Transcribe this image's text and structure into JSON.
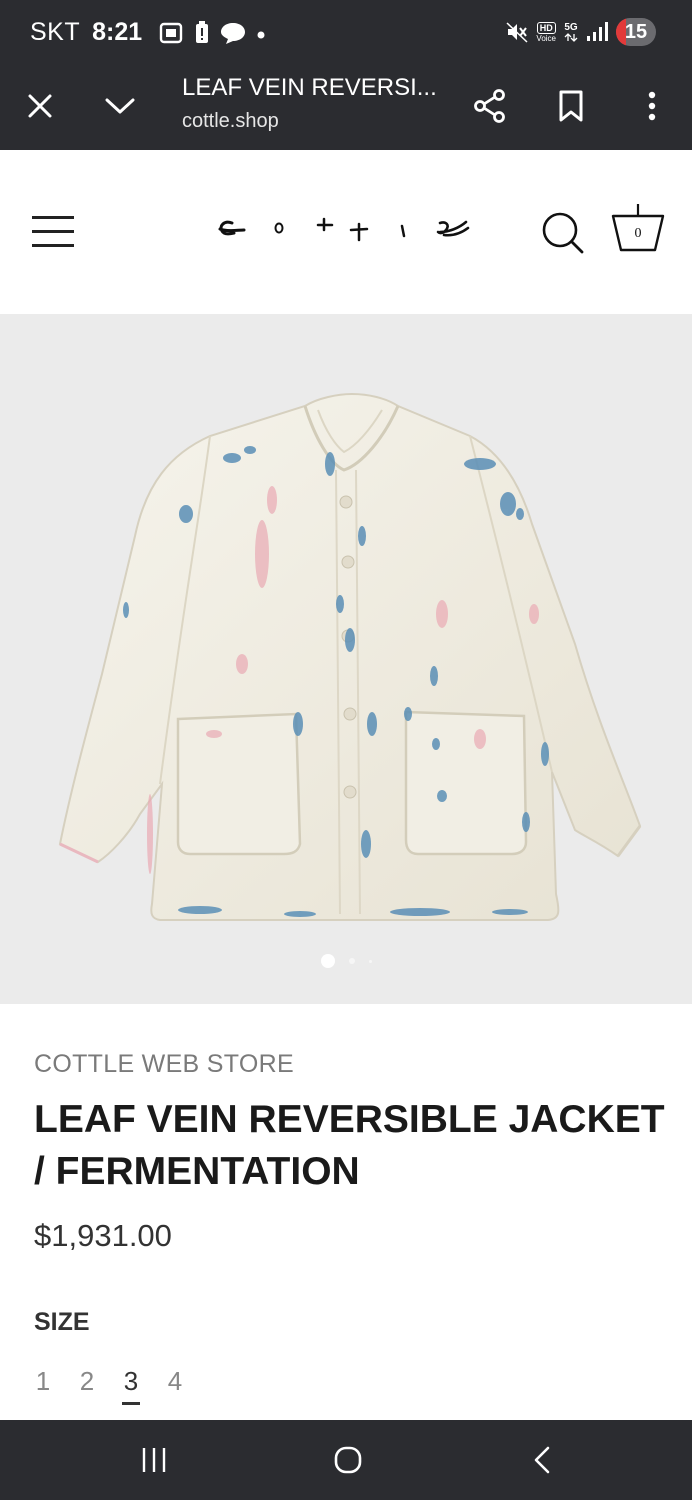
{
  "status_bar": {
    "carrier": "SKT",
    "time": "8:21",
    "hd_label": "HD",
    "voice_label": "Voice",
    "network": "5G",
    "battery": "15"
  },
  "browser": {
    "page_title": "LEAF VEIN REVERSI...",
    "url": "cottle.shop"
  },
  "site": {
    "cart_count": "0"
  },
  "product": {
    "store": "COTTLE WEB STORE",
    "title": "LEAF VEIN REVERSIBLE JACKET / FERMENTATION",
    "price": "$1,931.00",
    "size_label": "SIZE",
    "sizes": [
      "1",
      "2",
      "3",
      "4"
    ],
    "selected_size": "3",
    "image_count": 3,
    "current_image": 1
  },
  "colors": {
    "system_bar": "#2b2c30",
    "image_bg": "#ebebeb",
    "jacket": "#f3f0e6",
    "dye_blue": "#5b8fb6",
    "dye_pink": "#e9aab4"
  }
}
